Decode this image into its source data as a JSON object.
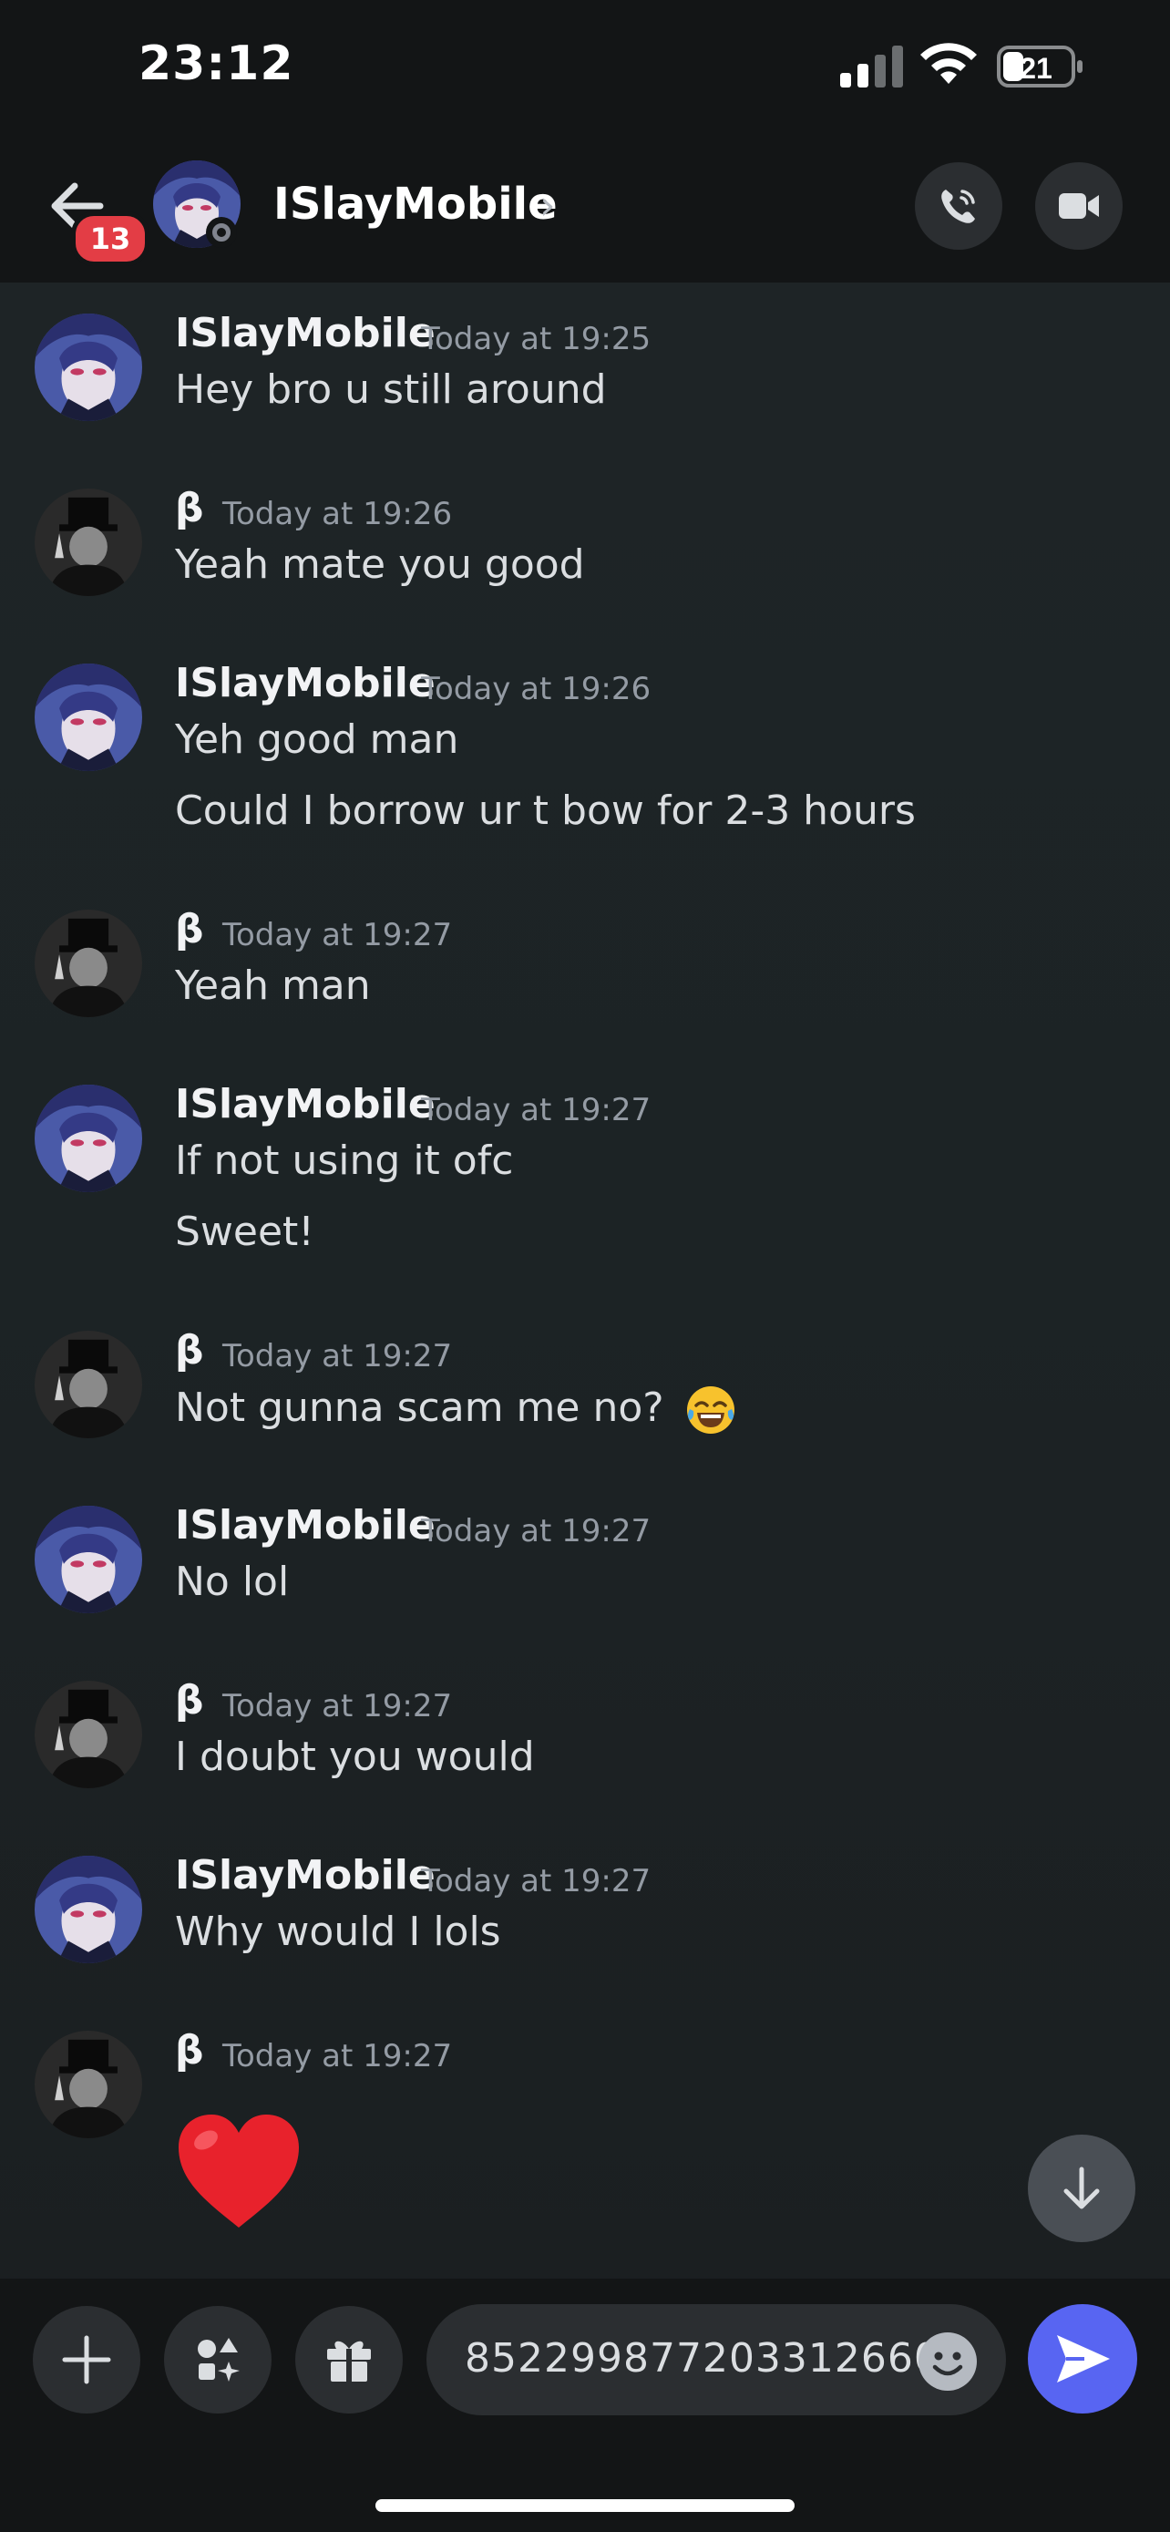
{
  "status_bar": {
    "time": "23:12",
    "battery_level": "21"
  },
  "header": {
    "back_badge_count": "13",
    "title": "ISlayMobile",
    "chevron": "›",
    "call_icon": "phone-icon",
    "video_icon": "video-camera-icon"
  },
  "messages": [
    {
      "author": "ISlayMobile",
      "timestamp": "Today at 19:25",
      "avatar": "anime-avatar",
      "lines": [
        "Hey bro u still around"
      ]
    },
    {
      "author": "β",
      "timestamp": "Today at 19:26",
      "avatar": "top-hat-avatar",
      "lines": [
        "Yeah mate you good"
      ]
    },
    {
      "author": "ISlayMobile",
      "timestamp": "Today at 19:26",
      "avatar": "anime-avatar",
      "lines": [
        "Yeh good man",
        "Could I borrow ur t bow for 2-3 hours"
      ]
    },
    {
      "author": "β",
      "timestamp": "Today at 19:27",
      "avatar": "top-hat-avatar",
      "lines": [
        "Yeah man"
      ]
    },
    {
      "author": "ISlayMobile",
      "timestamp": "Today at 19:27",
      "avatar": "anime-avatar",
      "lines": [
        "If not using it ofc",
        "Sweet!"
      ]
    },
    {
      "author": "β",
      "timestamp": "Today at 19:27",
      "avatar": "top-hat-avatar",
      "lines": [
        "Not gunna scam me no?"
      ],
      "emoji": "tears-of-joy-emoji"
    },
    {
      "author": "ISlayMobile",
      "timestamp": "Today at 19:27",
      "avatar": "anime-avatar",
      "lines": [
        "No lol"
      ]
    },
    {
      "author": "β",
      "timestamp": "Today at 19:27",
      "avatar": "top-hat-avatar",
      "lines": [
        "I doubt you would"
      ]
    },
    {
      "author": "ISlayMobile",
      "timestamp": "Today at 19:27",
      "avatar": "anime-avatar",
      "lines": [
        "Why would I lols"
      ]
    },
    {
      "author": "β",
      "timestamp": "Today at 19:27",
      "avatar": "top-hat-avatar",
      "lines": [],
      "emoji": "red-heart-emoji"
    }
  ],
  "composer": {
    "input_value": "85229987720331266​0",
    "buttons": [
      "plus-icon",
      "apps-icon",
      "gift-icon",
      "emoji-icon",
      "send-icon"
    ]
  },
  "colors": {
    "accent": "#5865f2",
    "badge": "#e33d45",
    "background": "#1b1f21"
  }
}
